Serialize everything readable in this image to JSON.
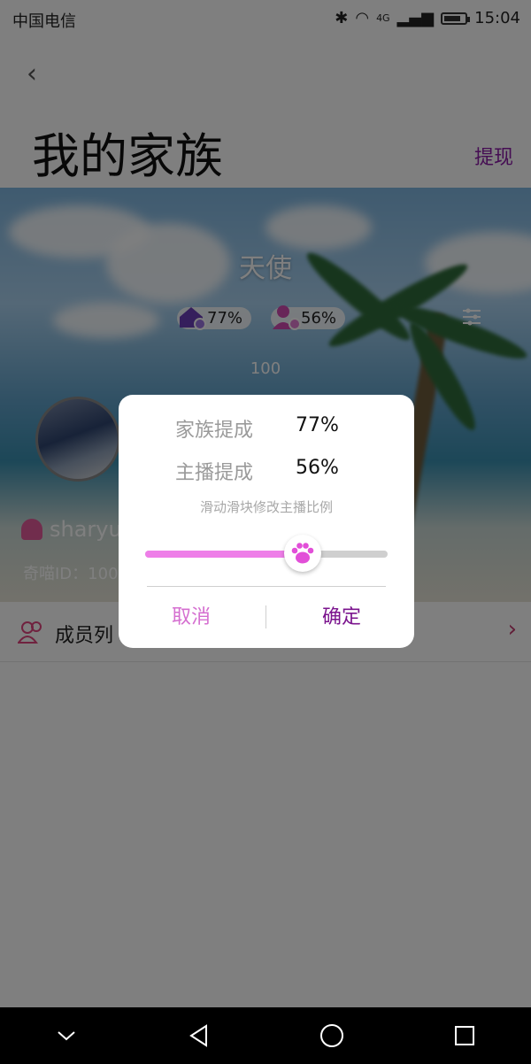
{
  "status_bar": {
    "carrier": "中国电信",
    "time": "15:04",
    "network": "4G"
  },
  "header": {
    "title": "我的家族",
    "withdraw_label": "提现"
  },
  "banner": {
    "family_name": "天使",
    "family_ratio": "77%",
    "anchor_ratio": "56%",
    "count": "100",
    "username": "sharyu",
    "qimiao_id": "奇喵ID：100"
  },
  "members": {
    "label": "成员列"
  },
  "dialog": {
    "family_label": "家族提成",
    "family_value": "77%",
    "anchor_label": "主播提成",
    "anchor_value": "56%",
    "hint": "滑动滑块修改主播比例",
    "slider_value": 0.65,
    "cancel_label": "取消",
    "confirm_label": "确定"
  },
  "colors": {
    "accent": "#7b148e",
    "slider_fill": "#ee7ee8",
    "cancel": "#d56fd0"
  }
}
